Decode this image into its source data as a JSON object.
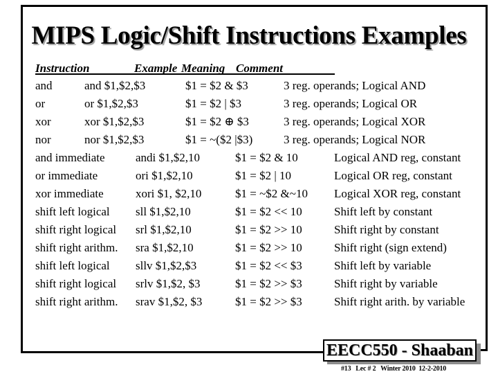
{
  "title": "MIPS Logic/Shift Instructions Examples",
  "table": {
    "headers": {
      "instruction": "Instruction",
      "example": "Example",
      "meaning": "Meaning",
      "comment": "Comment"
    },
    "rows": [
      {
        "instruction": "and",
        "example": "and $1,$2,$3",
        "meaning": "$1 = $2 & $3",
        "comment": "3 reg. operands; Logical AND"
      },
      {
        "instruction": "or",
        "example": "or $1,$2,$3",
        "meaning": "$1 = $2 | $3",
        "comment": "3 reg. operands; Logical OR"
      },
      {
        "instruction": "xor",
        "example": "xor $1,$2,$3",
        "meaning": "$1 = $2 ⊕ $3",
        "comment": "3 reg. operands; Logical XOR"
      },
      {
        "instruction": "nor",
        "example": "nor $1,$2,$3",
        "meaning": "$1 = ~($2 |$3)",
        "comment": "3 reg. operands; Logical NOR"
      },
      {
        "instruction": "and immediate",
        "example": "andi $1,$2,10",
        "meaning": "$1 = $2 & 10",
        "comment": "Logical AND reg, constant"
      },
      {
        "instruction": "or immediate",
        "example": "ori $1,$2,10",
        "meaning": "$1 = $2 | 10",
        "comment": "Logical OR reg, constant"
      },
      {
        "instruction": "xor immediate",
        "example": "xori $1, $2,10",
        "meaning": "$1 = ~$2 &~10",
        "comment": "Logical XOR reg, constant"
      },
      {
        "instruction": "shift left logical",
        "example": "sll $1,$2,10",
        "meaning": "$1 = $2 << 10",
        "comment": "Shift left by constant"
      },
      {
        "instruction": "shift right logical",
        "example": "srl $1,$2,10",
        "meaning": "$1 = $2 >> 10",
        "comment": "Shift right by constant"
      },
      {
        "instruction": "shift right arithm.",
        "example": "sra $1,$2,10",
        "meaning": "$1 = $2 >> 10",
        "comment": "Shift right (sign extend)"
      },
      {
        "instruction": "shift left logical",
        "example": "sllv $1,$2,$3",
        "meaning": "$1 = $2 << $3",
        "comment": "Shift left by variable"
      },
      {
        "instruction": "shift right logical",
        "example": "srlv $1,$2, $3",
        "meaning": "$1 = $2 >> $3",
        "comment": "Shift right by variable"
      },
      {
        "instruction": "shift right arithm.",
        "example": "srav $1,$2, $3",
        "meaning": "$1 = $2 >> $3",
        "comment": "Shift right arith. by variable"
      }
    ]
  },
  "footer": {
    "label": "EECC550 - Shaaban",
    "subtext": "#13   Lec # 2   Winter 2010  12-2-2010"
  }
}
